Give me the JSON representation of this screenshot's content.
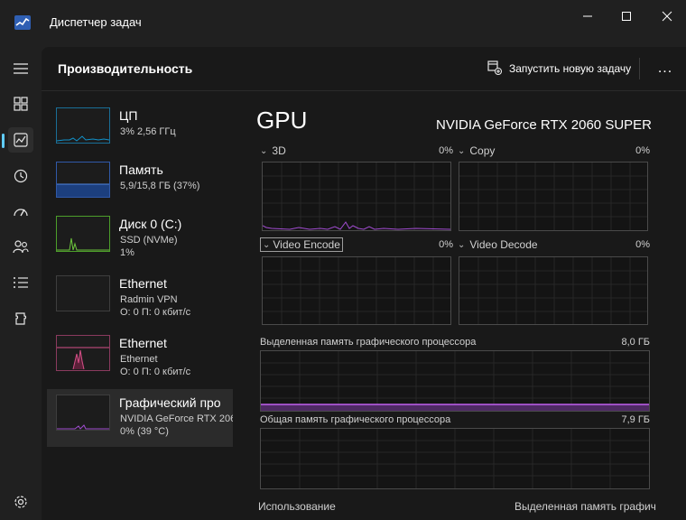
{
  "window": {
    "title": "Диспетчер задач"
  },
  "header": {
    "title": "Производительность",
    "run_task_label": "Запустить новую задачу",
    "more_label": "..."
  },
  "rail": {
    "items": [
      "menu-icon",
      "processes-icon",
      "performance-icon",
      "app-history-icon",
      "startup-apps-icon",
      "users-icon",
      "details-icon",
      "services-icon",
      "settings-icon"
    ],
    "active": "performance-icon"
  },
  "sidebar": {
    "items": [
      {
        "title": "ЦП",
        "line1": "3%  2,56 ГГц",
        "line2": ""
      },
      {
        "title": "Память",
        "line1": "5,9/15,8 ГБ (37%)",
        "line2": ""
      },
      {
        "title": "Диск 0 (C:)",
        "line1": "SSD (NVMe)",
        "line2": "1%"
      },
      {
        "title": "Ethernet",
        "line1": "Radmin VPN",
        "line2": "О: 0 П: 0 кбит/с"
      },
      {
        "title": "Ethernet",
        "line1": "Ethernet",
        "line2": "О: 0 П: 0 кбит/с"
      },
      {
        "title": "Графический про",
        "line1": "NVIDIA GeForce RTX 206",
        "line2": "0%  (39 °C)"
      }
    ],
    "selected_index": 5
  },
  "detail": {
    "title": "GPU",
    "model": "NVIDIA GeForce RTX 2060 SUPER",
    "engines": [
      {
        "name": "3D",
        "percent": "0%"
      },
      {
        "name": "Copy",
        "percent": "0%"
      },
      {
        "name": "Video Encode",
        "percent": "0%"
      },
      {
        "name": "Video Decode",
        "percent": "0%"
      }
    ],
    "dedicated_memory": {
      "label": "Выделенная память графического процессора",
      "value": "8,0 ГБ"
    },
    "shared_memory": {
      "label": "Общая память графического процессора",
      "value": "7,9 ГБ"
    },
    "footer": {
      "usage_label": "Использование",
      "dedicated_label": "Выделенная память графич"
    }
  },
  "colors": {
    "accent": "#60cdff",
    "cpu_line": "#1191c9",
    "memory_fill": "#1c3f7e",
    "disk_line": "#4c9e2a",
    "ethernet_line": "#d44f87",
    "gpu_line": "#a14cd1",
    "background": "#202020",
    "panel": "#191919"
  }
}
